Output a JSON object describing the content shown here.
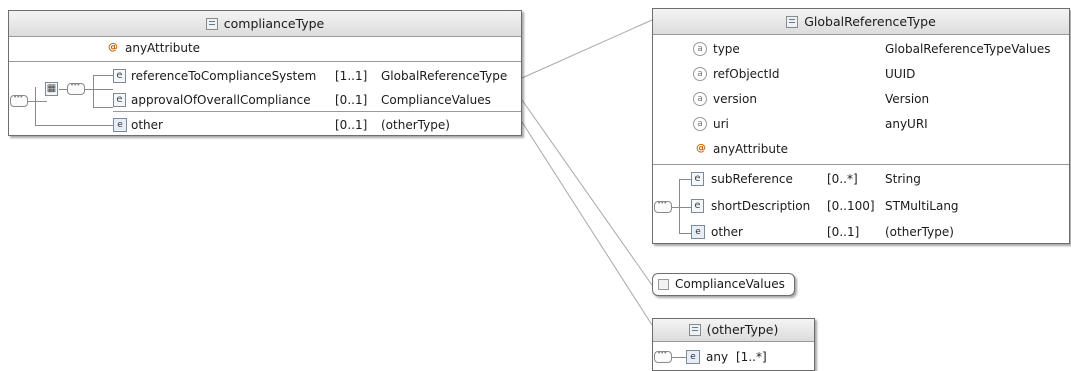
{
  "complianceType": {
    "title": "complianceType",
    "any_attribute": "anyAttribute",
    "elements": [
      {
        "name": "referenceToComplianceSystem",
        "card": "[1..1]",
        "type": "GlobalReferenceType"
      },
      {
        "name": "approvalOfOverallCompliance",
        "card": "[0..1]",
        "type": "ComplianceValues"
      },
      {
        "name": "other",
        "card": "[0..1]",
        "type": "(otherType)"
      }
    ]
  },
  "globalReferenceType": {
    "title": "GlobalReferenceType",
    "attributes": [
      {
        "name": "type",
        "type": "GlobalReferenceTypeValues"
      },
      {
        "name": "refObjectId",
        "type": "UUID"
      },
      {
        "name": "version",
        "type": "Version"
      },
      {
        "name": "uri",
        "type": "anyURI"
      }
    ],
    "any_attribute": "anyAttribute",
    "elements": [
      {
        "name": "subReference",
        "card": "[0..*]",
        "type": "String"
      },
      {
        "name": "shortDescription",
        "card": "[0..100]",
        "type": "STMultiLang"
      },
      {
        "name": "other",
        "card": "[0..1]",
        "type": "(otherType)"
      }
    ]
  },
  "complianceValues": {
    "title": "ComplianceValues"
  },
  "otherType": {
    "title": "(otherType)",
    "elements": [
      {
        "name": "any",
        "card": "[1..*]"
      }
    ]
  },
  "icons": {
    "type": "complex-type-icon",
    "element": "element-icon",
    "attribute": "attribute-icon",
    "any_attribute": "any-attribute-icon",
    "sequence": "sequence-icon",
    "simple_type": "simple-type-icon"
  },
  "colors": {
    "border": "#6e6e6e",
    "header_top": "#f4f4f4",
    "header_bottom": "#dcdcdc",
    "connector": "#a0a0a0"
  }
}
